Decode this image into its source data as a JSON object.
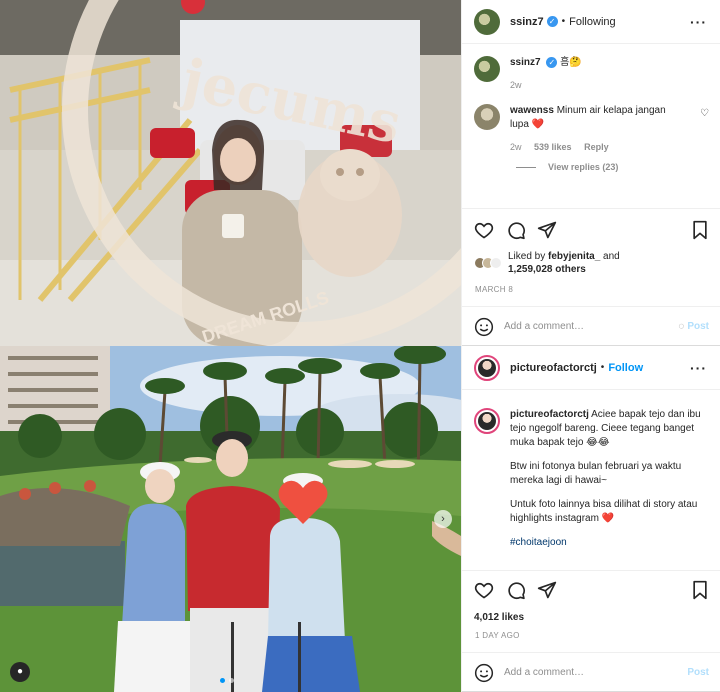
{
  "post1": {
    "user": "ssinz7",
    "follow_state": "Following",
    "sign_text_top": "jecums",
    "sign_text_bottom": "DREAM ROLLS",
    "comments": [
      {
        "user": "ssinz7",
        "text": "흠🤔",
        "time": "2w"
      },
      {
        "user": "wawenss",
        "text": "Minum air kelapa jangan lupa ❤️",
        "time": "2w",
        "likes": "539 likes",
        "reply": "Reply"
      }
    ],
    "view_replies": "View replies (23)",
    "liked_by_prefix": "Liked by ",
    "liked_by_user": "febyjenita_",
    "liked_by_suffix": " and",
    "liked_by_count": "1,259,028 others",
    "date": "MARCH 8",
    "add_comment_placeholder": "Add a comment…",
    "post_label": "Post"
  },
  "post2": {
    "user": "pictureofactorctj",
    "follow_label": "Follow",
    "caption_user": "pictureofactorctj",
    "caption_p1": "Aciee bapak tejo dan ibu tejo ngegolf bareng. Cieee tegang banget muka bapak tejo 😂😂",
    "caption_p2": "Btw ini fotonya bulan februari ya waktu mereka lagi di hawai~",
    "caption_p3": "Untuk foto lainnya bisa dilihat di story atau highlights instagram ❤️",
    "hashtag": "#choitaejoon",
    "likes": "4,012 likes",
    "date": "1 DAY AGO",
    "add_comment_placeholder": "Add a comment…",
    "post_label": "Post"
  },
  "colors": {
    "link": "#0095f6",
    "verified": "#3897f0",
    "muted": "#8e8e8e"
  }
}
